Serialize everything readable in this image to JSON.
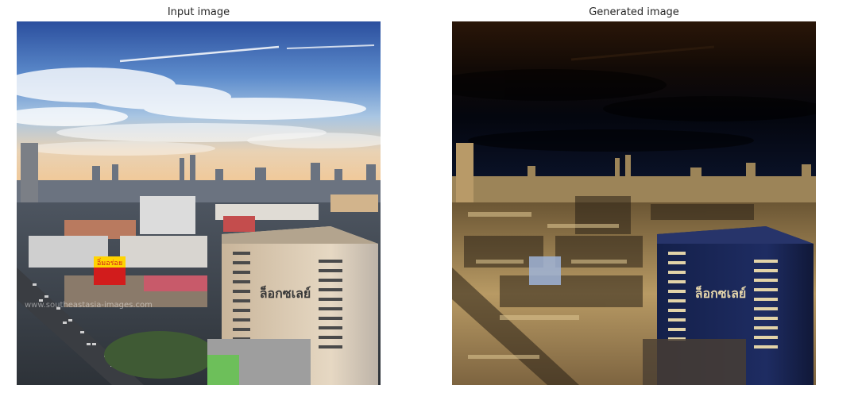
{
  "figure": {
    "panels": [
      {
        "title": "Input image",
        "content": "city skyline photo under a blue sky with clouds, large beige office building in the foreground",
        "overlay_text": "ล็อกซเลย์",
        "billboard_text": "อิ่มอร่อย",
        "watermark": "www.southeastasia-images.com"
      },
      {
        "title": "Generated image",
        "content": "stylised version of the same city scene with a dark brown/black sky, golden tones, and a dark blue foreground building",
        "overlay_text": "ล็อกซเลย์"
      }
    ],
    "colors": {
      "input_sky_top": "#2b4f9e",
      "input_sky_mid": "#8fb6dd",
      "input_horizon": "#f0c99a",
      "generated_sky_top": "#2a1608",
      "generated_sky_mid": "#04060e",
      "generated_city": "#c8a46a",
      "generated_building": "#14204a"
    }
  }
}
